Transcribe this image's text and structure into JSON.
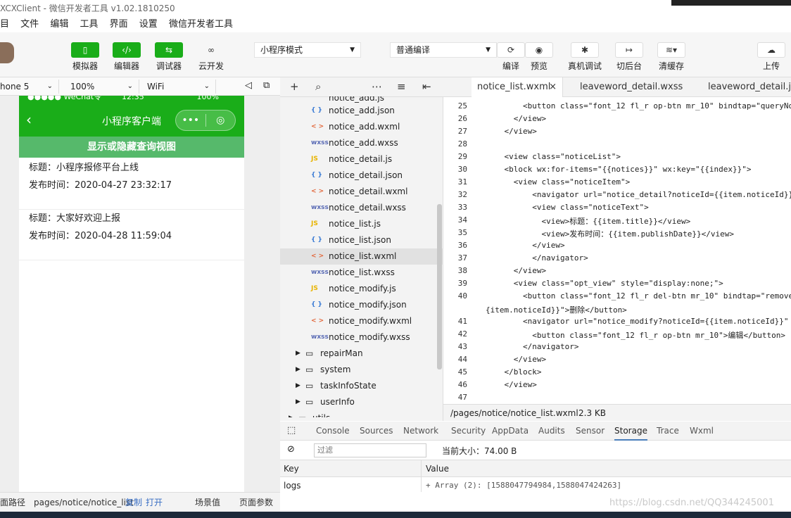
{
  "window": {
    "title": "XCXClient - 微信开发者工具 v1.02.1810250"
  },
  "menu": [
    "目",
    "文件",
    "编辑",
    "工具",
    "界面",
    "设置",
    "微信开发者工具"
  ],
  "toolbar": {
    "simulator": "模拟器",
    "editor": "编辑器",
    "debugger": "调试器",
    "cloud": "云开发",
    "mode_select": "小程序模式",
    "compile_select": "普通编译",
    "compile": "编译",
    "preview": "预览",
    "remote_debug": "真机调试",
    "background": "切后台",
    "clear_cache": "清缓存",
    "upload": "上传"
  },
  "device_bar": {
    "device": "hone 5",
    "zoom": "100%",
    "network": "WiFi"
  },
  "phone": {
    "status_carrier": "●●●●● WeChat令",
    "status_time": "12:35",
    "status_battery": "100%",
    "nav_title": "小程序客户端",
    "toggle_label": "显示或隐藏查询视图",
    "notices": [
      {
        "title": "标题：小程序报修平台上线",
        "date": "发布时间：2020-04-27 23:32:17"
      },
      {
        "title": "标题：大家好欢迎上报",
        "date": "发布时间：2020-04-28 11:59:04"
      }
    ]
  },
  "file_tree": {
    "top_partial": "notice_add.js",
    "files": [
      {
        "type": "json",
        "icon": "{ }",
        "name": "notice_add.json"
      },
      {
        "type": "wxml",
        "icon": "< >",
        "name": "notice_add.wxml"
      },
      {
        "type": "wxss",
        "icon": "wxss",
        "name": "notice_add.wxss"
      },
      {
        "type": "js",
        "icon": "JS",
        "name": "notice_detail.js"
      },
      {
        "type": "json",
        "icon": "{ }",
        "name": "notice_detail.json"
      },
      {
        "type": "wxml",
        "icon": "< >",
        "name": "notice_detail.wxml"
      },
      {
        "type": "wxss",
        "icon": "wxss",
        "name": "notice_detail.wxss"
      },
      {
        "type": "js",
        "icon": "JS",
        "name": "notice_list.js"
      },
      {
        "type": "json",
        "icon": "{ }",
        "name": "notice_list.json"
      },
      {
        "type": "wxml",
        "icon": "< >",
        "name": "notice_list.wxml"
      },
      {
        "type": "wxss",
        "icon": "wxss",
        "name": "notice_list.wxss"
      },
      {
        "type": "js",
        "icon": "JS",
        "name": "notice_modify.js"
      },
      {
        "type": "json",
        "icon": "{ }",
        "name": "notice_modify.json"
      },
      {
        "type": "wxml",
        "icon": "< >",
        "name": "notice_modify.wxml"
      },
      {
        "type": "wxss",
        "icon": "wxss",
        "name": "notice_modify.wxss"
      }
    ],
    "folders": [
      "repairMan",
      "system",
      "taskInfoState",
      "userInfo",
      "utils"
    ]
  },
  "editor": {
    "tabs": [
      "notice_list.wxml",
      "leaveword_detail.wxss",
      "leaveword_detail.json"
    ],
    "lines": [
      {
        "n": "25",
        "t": "        <button class=\"font_12 fl_r op-btn mr_10\" bindtap=\"queryNot"
      },
      {
        "n": "26",
        "t": "      </view>"
      },
      {
        "n": "27",
        "t": "    </view>"
      },
      {
        "n": "28",
        "t": ""
      },
      {
        "n": "29",
        "t": "    <view class=\"noticeList\">"
      },
      {
        "n": "30",
        "t": "    <block wx:for-items=\"{{notices}}\" wx:key=\"{{index}}\">"
      },
      {
        "n": "31",
        "t": "      <view class=\"noticeItem\">"
      },
      {
        "n": "32",
        "t": "          <navigator url=\"notice_detail?noticeId={{item.noticeId}}\""
      },
      {
        "n": "33",
        "t": "          <view class=\"noticeText\">"
      },
      {
        "n": "34",
        "t": "            <view>标题：{{item.title}}</view>"
      },
      {
        "n": "35",
        "t": "            <view>发布时间：{{item.publishDate}}</view>"
      },
      {
        "n": "36",
        "t": "          </view>"
      },
      {
        "n": "37",
        "t": "          </navigator>"
      },
      {
        "n": "38",
        "t": "      </view>"
      },
      {
        "n": "39",
        "t": "      <view class=\"opt_view\" style=\"display:none;\">"
      },
      {
        "n": "40",
        "t": "        <button class=\"font_12 fl_r del-btn mr_10\" bindtap=\"removeNo"
      },
      {
        "n": "",
        "t": "{item.noticeId}}\">删除</button>"
      },
      {
        "n": "41",
        "t": "        <navigator url=\"notice_modify?noticeId={{item.noticeId}}\" ho"
      },
      {
        "n": "42",
        "t": "          <button class=\"font_12 fl_r op-btn mr_10\">编辑</button>"
      },
      {
        "n": "43",
        "t": "        </navigator>"
      },
      {
        "n": "44",
        "t": "      </view>"
      },
      {
        "n": "45",
        "t": "    </block>"
      },
      {
        "n": "46",
        "t": "    </view>"
      },
      {
        "n": "47",
        "t": ""
      }
    ],
    "status_path": "/pages/notice/notice_list.wxml",
    "status_size": "2.3 KB"
  },
  "devtools": {
    "tabs": [
      "Console",
      "Sources",
      "Network",
      "Security",
      "AppData",
      "Audits",
      "Sensor",
      "Storage",
      "Trace",
      "Wxml"
    ],
    "active_tab": "Storage",
    "filter_placeholder": "过滤",
    "current_size": "当前大小：74.00 B",
    "key_header": "Key",
    "value_header": "Value",
    "row_key": "logs",
    "row_value": "+ Array (2): [1588047794984,1588047424263]"
  },
  "bottom_bar": {
    "path_label": "面路径",
    "path": "pages/notice/notice_list",
    "copy": "复制",
    "open": "打开",
    "scene": "场景值",
    "params": "页面参数"
  },
  "watermark": "https://blog.csdn.net/QQ344245001",
  "colors": {
    "brand_green": "#1aad19",
    "toggle_green": "#56b96b"
  }
}
